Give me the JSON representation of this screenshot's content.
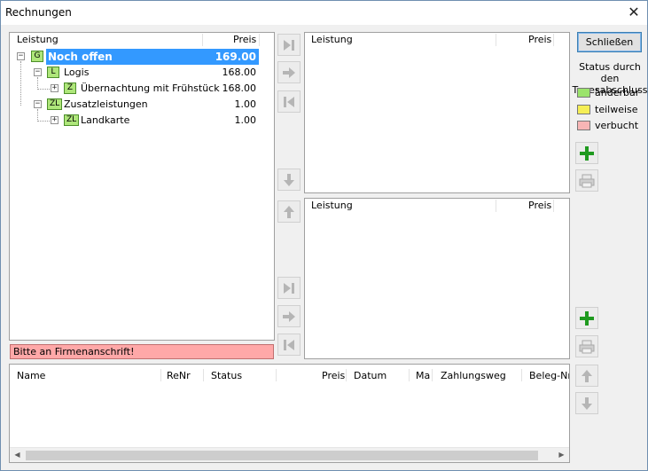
{
  "window": {
    "title": "Rechnungen"
  },
  "tree_panel": {
    "col_leistung": "Leistung",
    "col_preis": "Preis",
    "rows": [
      {
        "tag": "G",
        "label": "Noch offen",
        "value": "169.00",
        "selected": true
      },
      {
        "tag": "L",
        "label": "Logis",
        "value": "168.00"
      },
      {
        "tag": "Z",
        "label": "Übernachtung mit Frühstück",
        "value": "168.00"
      },
      {
        "tag": "ZL",
        "label": "Zusatzleistungen",
        "value": "1.00"
      },
      {
        "tag": "ZL",
        "label": "Landkarte",
        "value": "1.00"
      }
    ]
  },
  "upper_panel": {
    "col_leistung": "Leistung",
    "col_preis": "Preis"
  },
  "lower_panel": {
    "col_leistung": "Leistung",
    "col_preis": "Preis"
  },
  "warning": {
    "text": "Bitte an Firmenanschrift!"
  },
  "invoice_table": {
    "columns": [
      "Name",
      "ReNr",
      "Status",
      "Preis",
      "Datum",
      "Ma",
      "Zahlungsweg",
      "Beleg-Nr"
    ]
  },
  "sidebar": {
    "close_label": "Schließen",
    "status_heading": "Status durch den Tagesabschluss",
    "legend": [
      {
        "label": "änderbar",
        "color": "#9be36b"
      },
      {
        "label": "teilweise",
        "color": "#f5ee55"
      },
      {
        "label": "verbucht",
        "color": "#f8b5b5"
      }
    ]
  }
}
